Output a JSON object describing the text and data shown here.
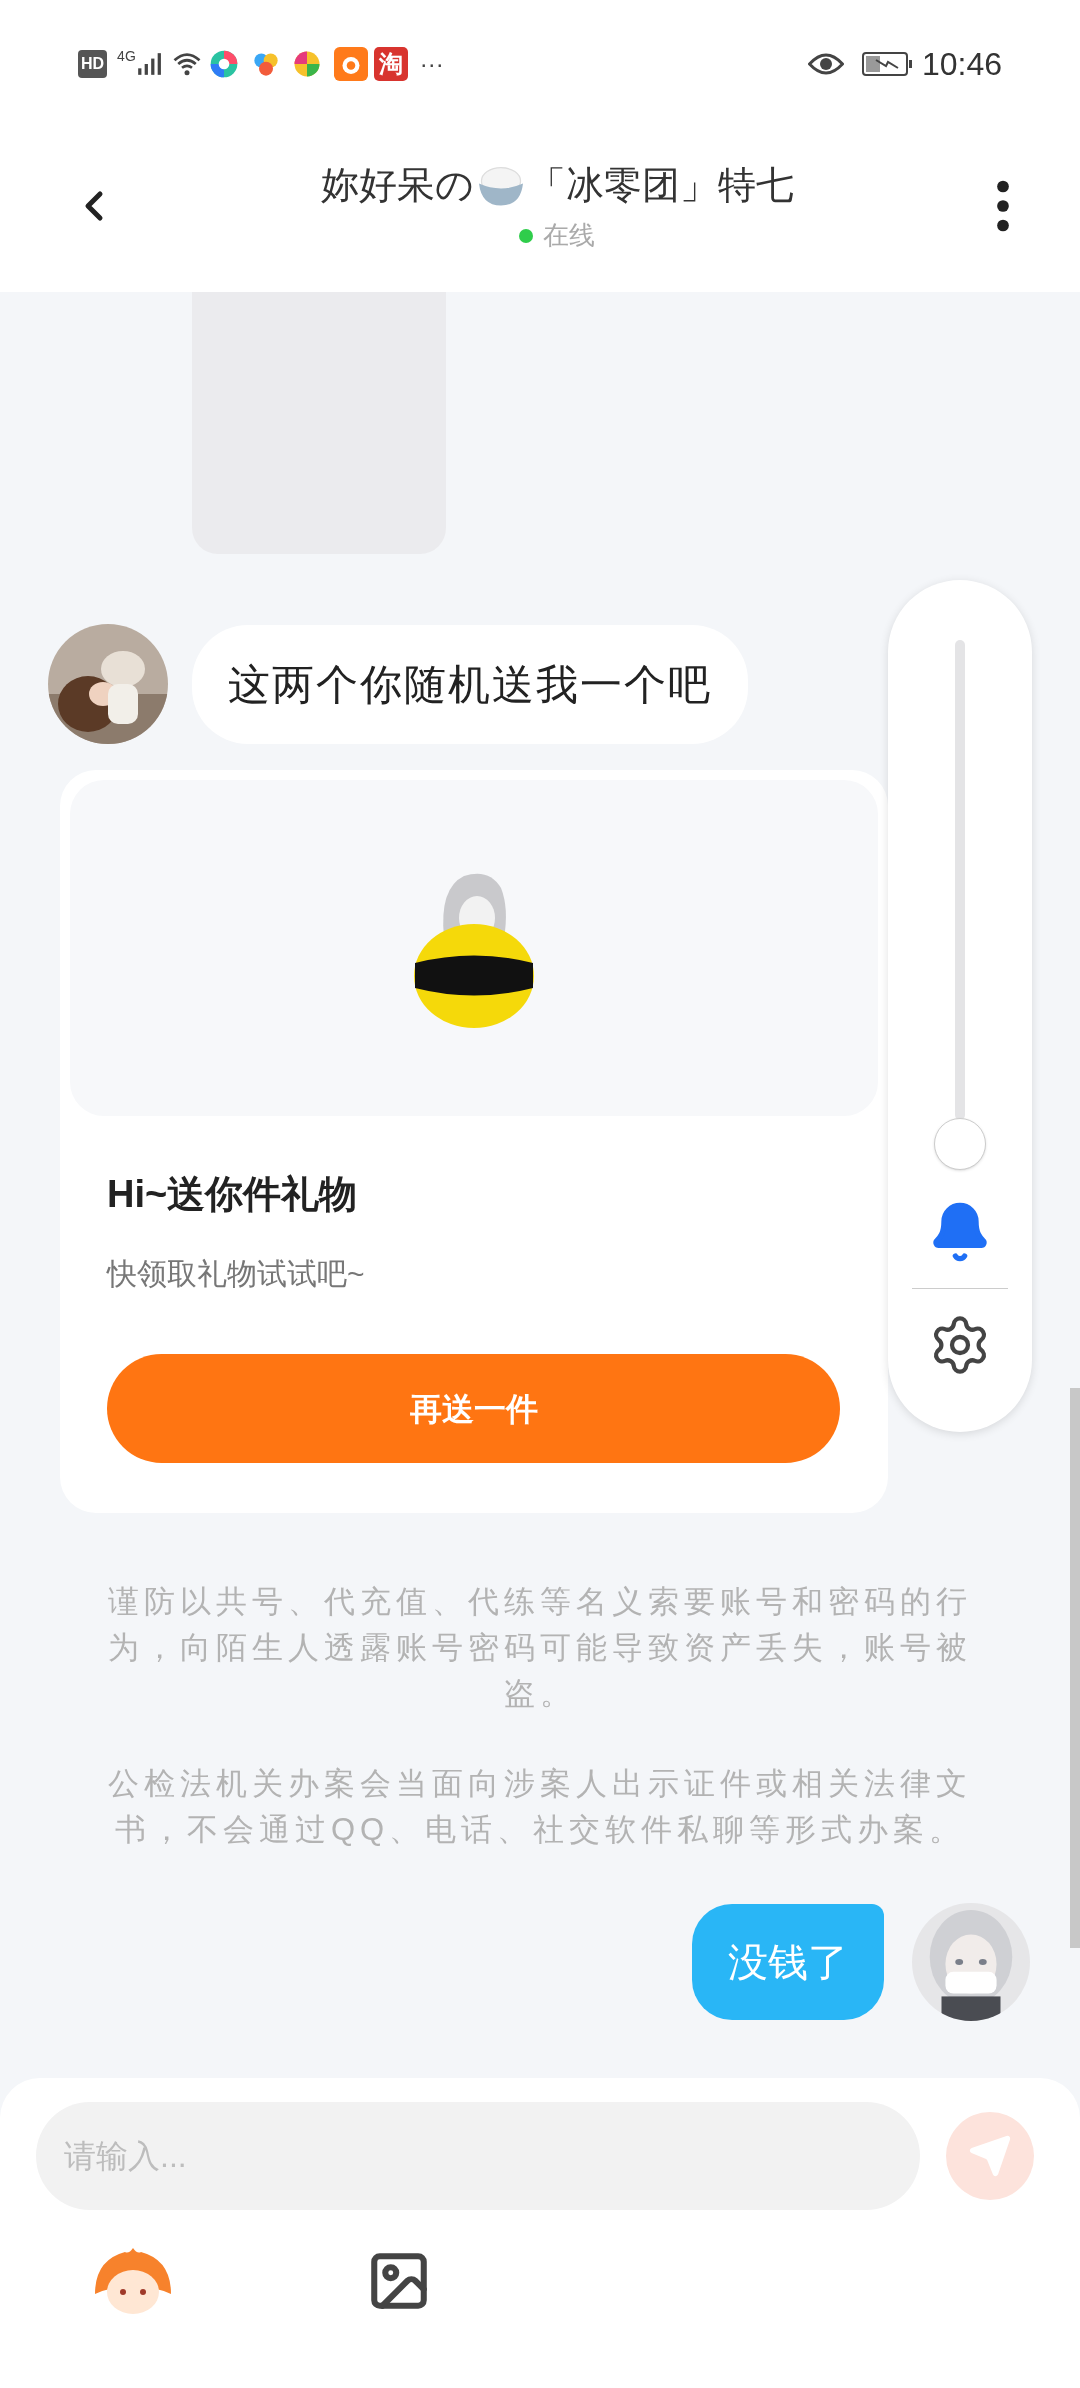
{
  "status_bar": {
    "hd": "HD",
    "network": "4G",
    "app_badge": "淘",
    "more": "···",
    "time": "10:46"
  },
  "header": {
    "title_before_icon": "妳好呆の",
    "title_after_icon": "「冰零团」特七",
    "status": "在线",
    "online": true
  },
  "messages": [
    {
      "kind": "received",
      "text": "这两个你随机送我一个吧"
    },
    {
      "kind": "gift",
      "title": "Hi~送你件礼物",
      "subtitle": "快领取礼物试试吧~",
      "button": "再送一件"
    },
    {
      "kind": "notice",
      "paragraphs": [
        "谨防以共号、代充值、代练等名义索要账号和密码的行为，向陌生人透露账号密码可能导致资产丢失，账号被盗。",
        "公检法机关办案会当面向涉案人出示证件或相关法律文书，不会通过QQ、电话、社交软件私聊等形式办案。"
      ]
    },
    {
      "kind": "sent",
      "text": "没钱了"
    }
  ],
  "float_panel": {
    "slider": {
      "level": 0
    },
    "notifications_on": true
  },
  "composer": {
    "placeholder": "请输入...",
    "send_enabled": false
  }
}
